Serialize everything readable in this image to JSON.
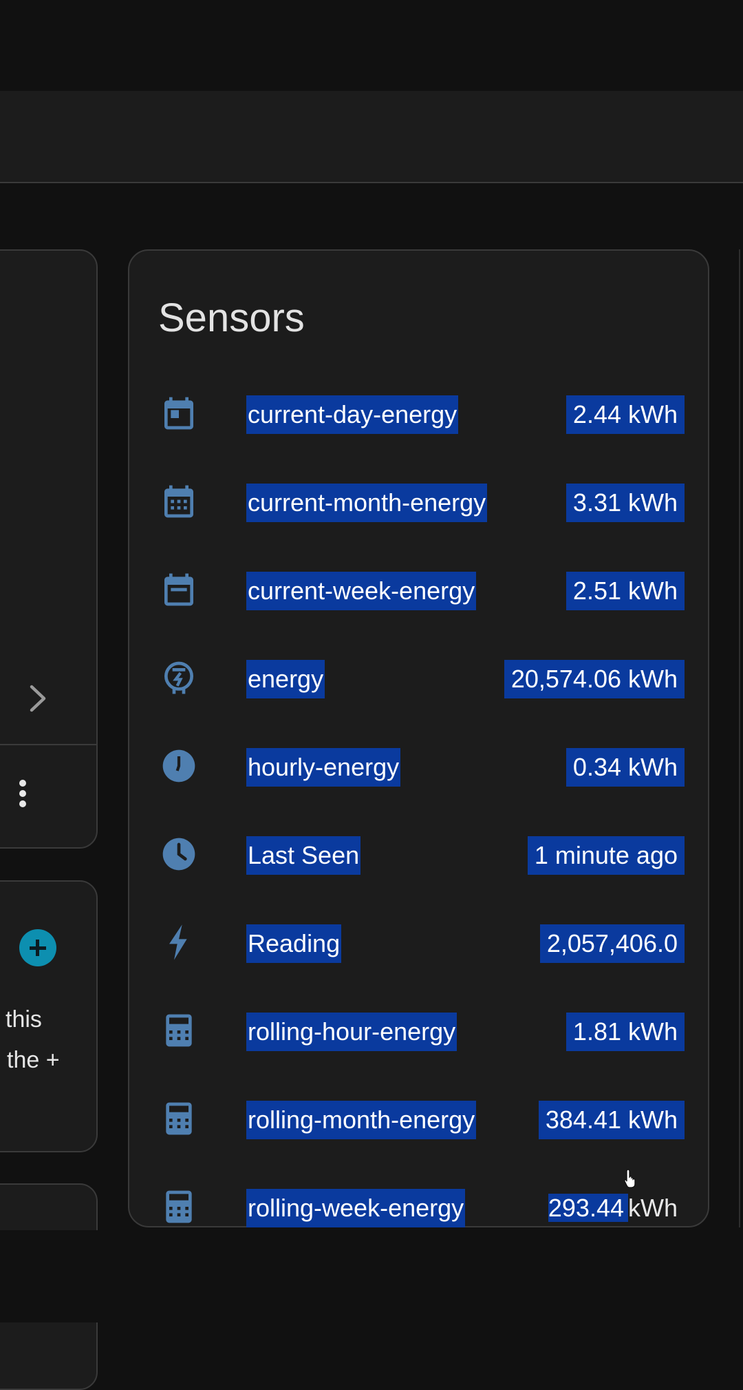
{
  "left_panel": {
    "hint_line1": "this",
    "hint_line2": "the +"
  },
  "sensors": {
    "title": "Sensors",
    "icon_color": "#4f7fb0",
    "highlight_color": "#0a3a9e",
    "items": [
      {
        "icon": "calendar-today-icon",
        "name": "current-day-energy",
        "value": "2.44 kWh"
      },
      {
        "icon": "calendar-month-icon",
        "name": "current-month-energy",
        "value": "3.31 kWh"
      },
      {
        "icon": "calendar-week-icon",
        "name": "current-week-energy",
        "value": "2.51 kWh"
      },
      {
        "icon": "meter-electric-icon",
        "name": "energy",
        "value": "20,574.06 kWh"
      },
      {
        "icon": "clock-pie-icon",
        "name": "hourly-energy",
        "value": "0.34 kWh"
      },
      {
        "icon": "clock-icon",
        "name": "Last Seen",
        "value": "1 minute ago"
      },
      {
        "icon": "flash-icon",
        "name": "Reading",
        "value": "2,057,406.0"
      },
      {
        "icon": "calculator-icon",
        "name": "rolling-hour-energy",
        "value": "1.81 kWh"
      },
      {
        "icon": "calculator-icon",
        "name": "rolling-month-energy",
        "value": "384.41 kWh"
      },
      {
        "icon": "calculator-icon",
        "name": "rolling-week-energy",
        "value_number": "293.44",
        "value_unit": "kWh"
      }
    ]
  }
}
